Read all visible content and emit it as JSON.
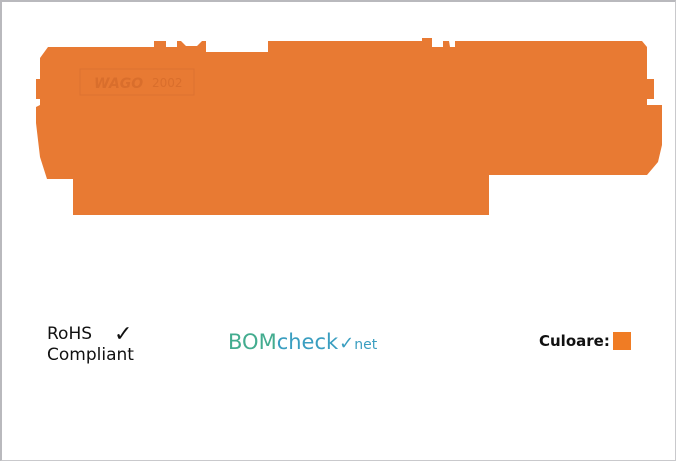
{
  "product": {
    "brand_text": "WAGO",
    "model_text": "2002",
    "color": "#e87a33"
  },
  "rohs": {
    "line1": "RoHS",
    "line2": "Compliant",
    "check": "✓"
  },
  "bomcheck": {
    "part1": "BOM",
    "part2": "check",
    "part3": "✓",
    "part4": "net"
  },
  "color_label": {
    "label": "Culoare:",
    "swatch_color": "#f07c24"
  }
}
